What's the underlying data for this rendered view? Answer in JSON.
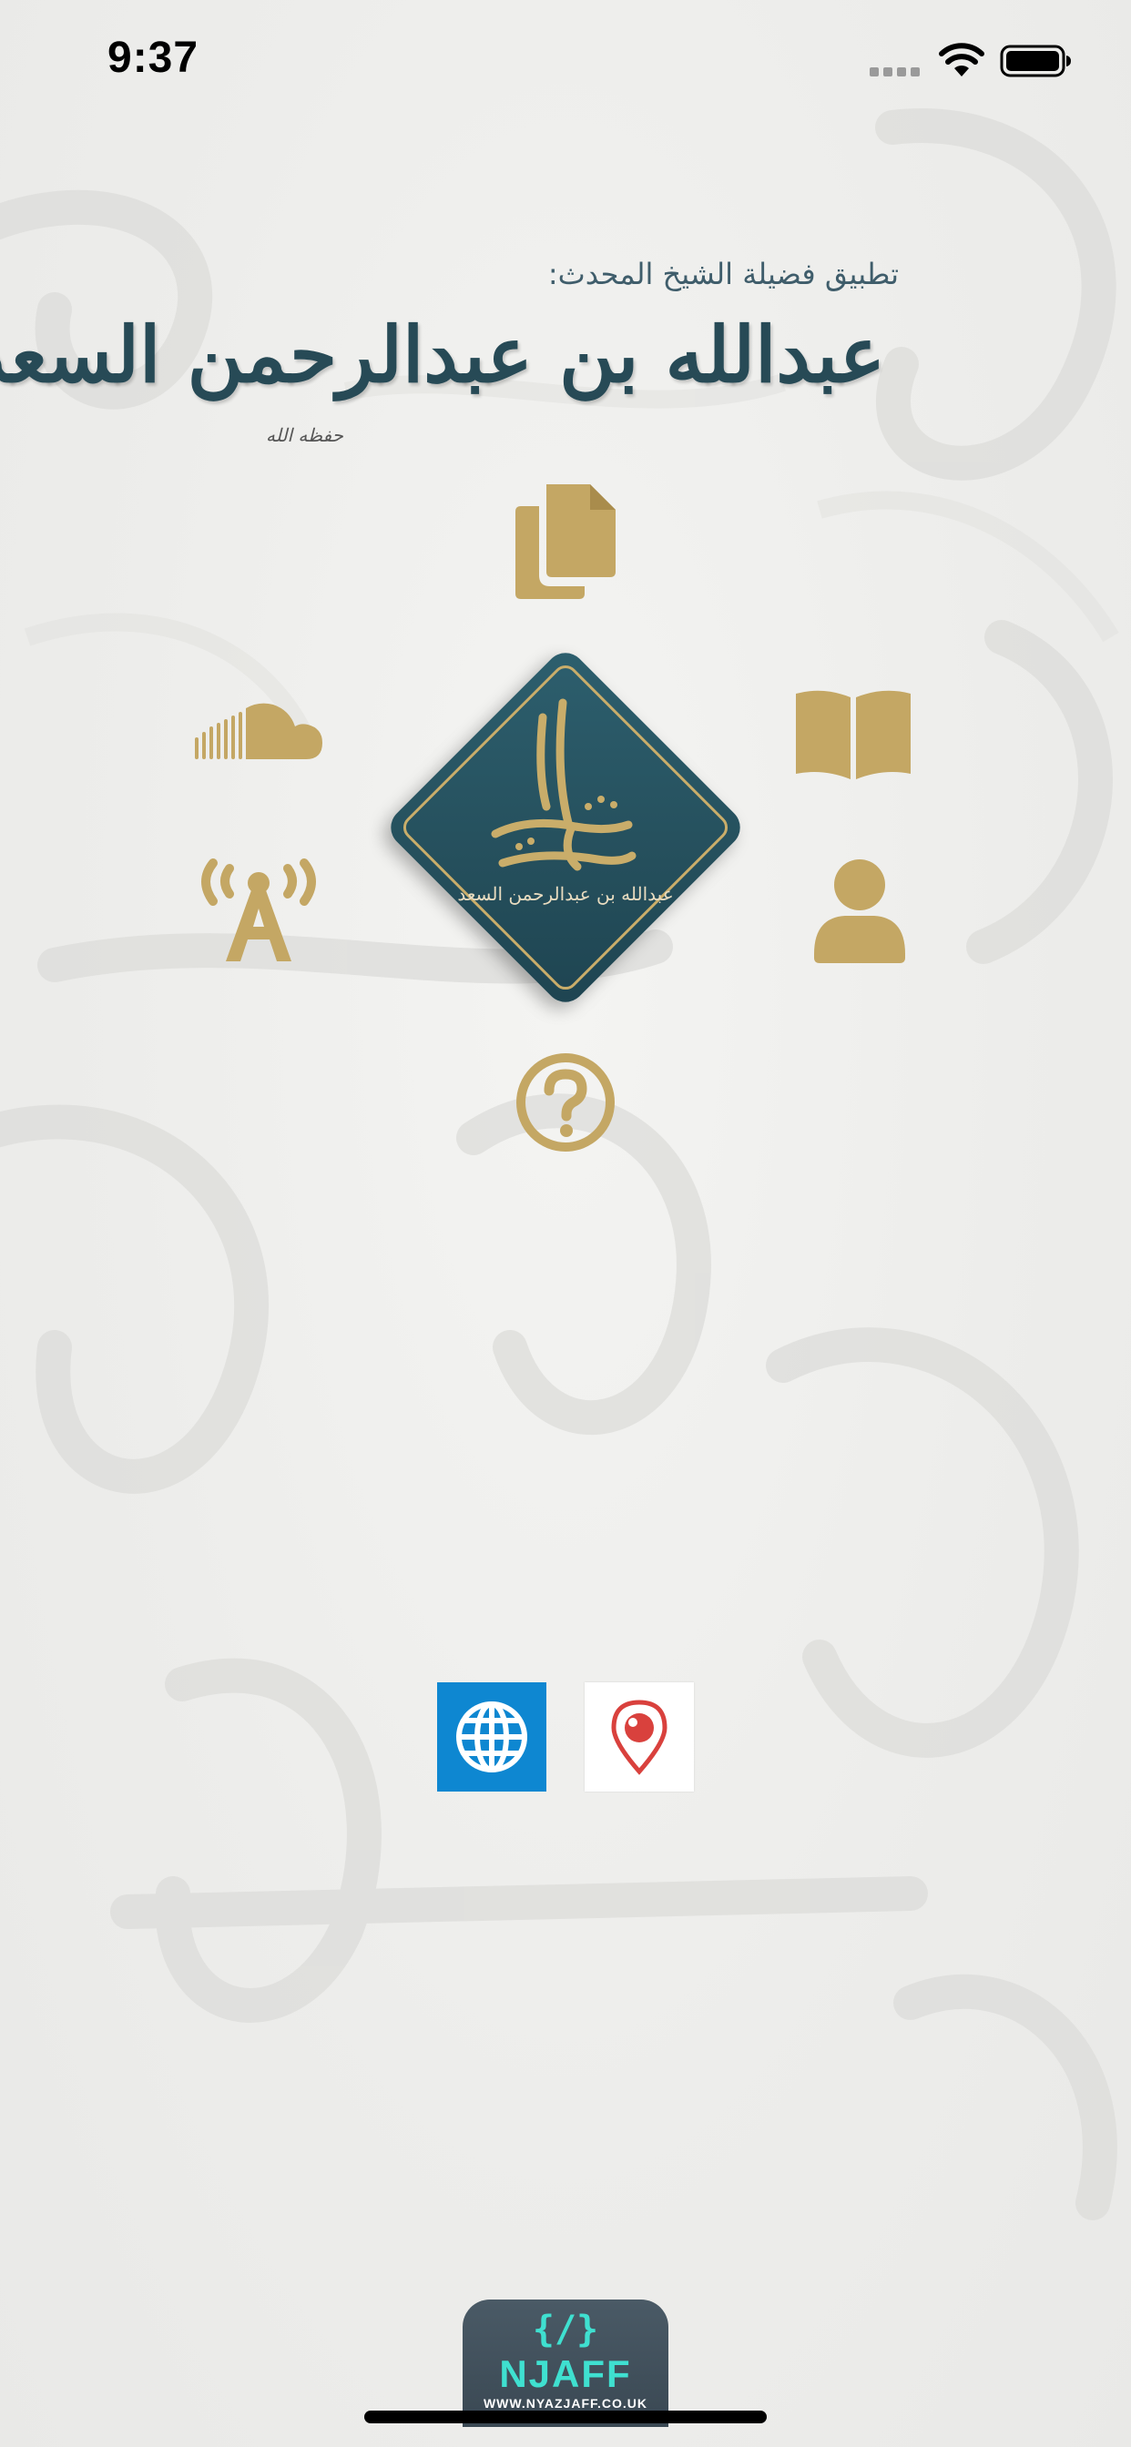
{
  "status_bar": {
    "time": "9:37"
  },
  "header": {
    "subtitle": "تطبيق فضيلة الشيخ المحدث:",
    "name": "عبدالله بن عبدالرحمن السعد",
    "honorific": "حفظه الله"
  },
  "logo": {
    "caption": "عبدالله بن عبدالرحمن السعد",
    "mark_text": "السعد"
  },
  "menu": {
    "items": [
      {
        "id": "documents",
        "icon": "documents-icon"
      },
      {
        "id": "book",
        "icon": "book-icon"
      },
      {
        "id": "soundcloud",
        "icon": "soundcloud-icon"
      },
      {
        "id": "broadcast",
        "icon": "broadcast-icon"
      },
      {
        "id": "profile",
        "icon": "person-icon"
      },
      {
        "id": "help",
        "icon": "question-icon"
      }
    ]
  },
  "social": [
    {
      "id": "website",
      "icon": "globe-icon"
    },
    {
      "id": "periscope",
      "icon": "periscope-icon"
    }
  ],
  "developer": {
    "code_mark": "{/}",
    "name": "NJAFF",
    "url": "WWW.NYAZJAFF.CO.UK"
  },
  "colors": {
    "gold": "#c4a764",
    "teal": "#254f5c",
    "web_blue": "#0e87d1",
    "periscope_red": "#d9413d",
    "dev_cyan": "#3fe0d0"
  }
}
